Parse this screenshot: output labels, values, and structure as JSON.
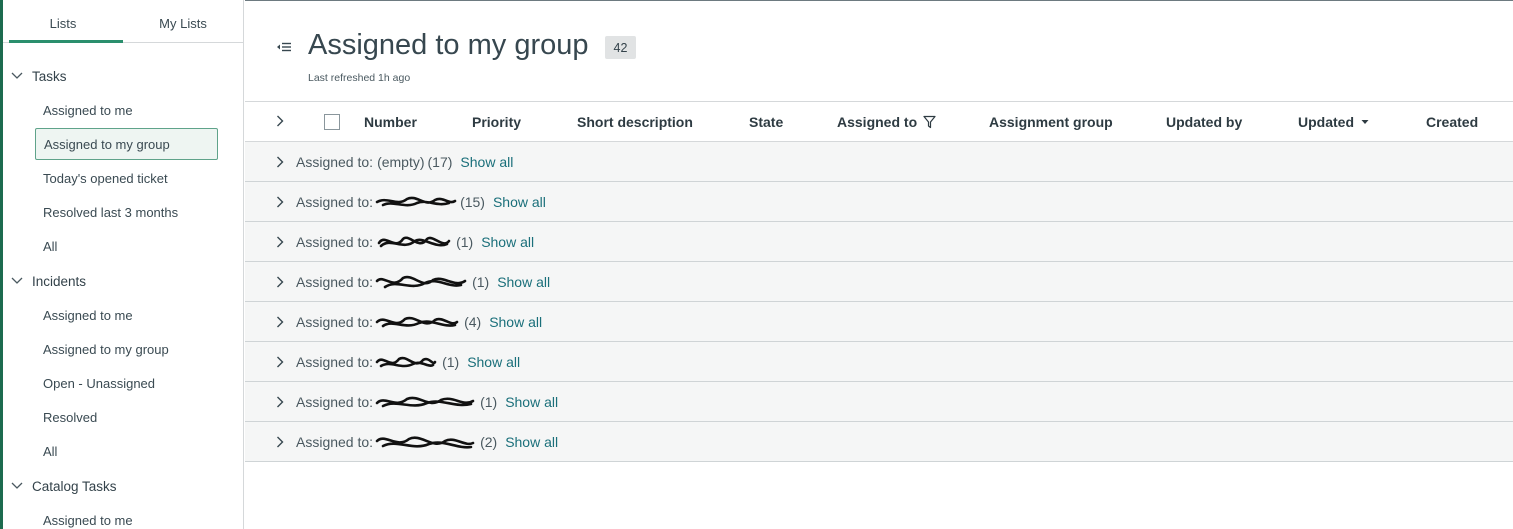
{
  "sidebar": {
    "tabs": [
      {
        "label": "Lists"
      },
      {
        "label": "My Lists"
      }
    ],
    "sections": [
      {
        "label": "Tasks",
        "items": [
          "Assigned to me",
          "Assigned to my group",
          "Today's opened ticket",
          "Resolved last 3 months",
          "All"
        ]
      },
      {
        "label": "Incidents",
        "items": [
          "Assigned to me",
          "Assigned to my group",
          "Open - Unassigned",
          "Resolved",
          "All"
        ]
      },
      {
        "label": "Catalog Tasks",
        "items": [
          "Assigned to me"
        ]
      }
    ],
    "active_item": "Assigned to my group",
    "accent_color": "#2a8f6d"
  },
  "list": {
    "title": "Assigned to my group",
    "count": "42",
    "last_refreshed": "Last refreshed 1h ago",
    "columns": [
      "Number",
      "Priority",
      "Short description",
      "State",
      "Assigned to",
      "Assignment group",
      "Updated by",
      "Updated",
      "Created"
    ],
    "group_prefix": "Assigned to:",
    "groups": [
      {
        "name": "(empty)",
        "count": "(17)"
      },
      {
        "name": "",
        "count": "(15)"
      },
      {
        "name": "",
        "count": "(1)"
      },
      {
        "name": "",
        "count": "(1)"
      },
      {
        "name": "",
        "count": "(4)"
      },
      {
        "name": "",
        "count": "(1)"
      },
      {
        "name": "",
        "count": "(1)"
      },
      {
        "name": "",
        "count": "(2)"
      }
    ],
    "show_all_label": "Show all",
    "highlight_color": "#f5f52a",
    "link_color": "#1a6f7a"
  },
  "icons": {
    "collapse": "list-collapse-icon",
    "filter": "filter-icon",
    "sort": "sort-descending-icon",
    "chevron": "chevron-right-icon",
    "section": "chevron-down-icon"
  }
}
